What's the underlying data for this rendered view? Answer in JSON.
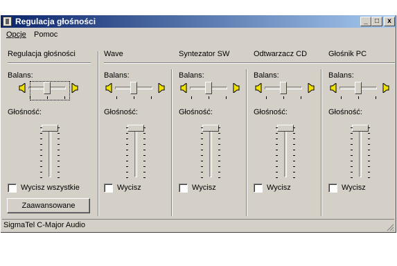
{
  "window": {
    "title": "Regulacja głośności",
    "minimize": "_",
    "maximize": "□",
    "close": "x"
  },
  "menu": {
    "options": "Opcje",
    "help": "Pomoc"
  },
  "master": {
    "title": "Regulacja głośności",
    "balance_label": "Balans:",
    "volume_label": "Głośność:",
    "mute_label": "Wycisz wszystkie",
    "advanced_button": "Zaawansowane",
    "muted": false,
    "balance": 0.5,
    "volume": 1.0
  },
  "channels": [
    {
      "title": "Wave",
      "balance_label": "Balans:",
      "volume_label": "Głośność:",
      "mute_label": "Wycisz",
      "muted": false,
      "balance": 0.5,
      "volume": 1.0
    },
    {
      "title": "Syntezator SW",
      "balance_label": "Balans:",
      "volume_label": "Głośność:",
      "mute_label": "Wycisz",
      "muted": false,
      "balance": 0.5,
      "volume": 1.0
    },
    {
      "title": "Odtwarzacz CD",
      "balance_label": "Balans:",
      "volume_label": "Głośność:",
      "mute_label": "Wycisz",
      "muted": false,
      "balance": 0.5,
      "volume": 1.0
    },
    {
      "title": "Głośnik PC",
      "balance_label": "Balans:",
      "volume_label": "Głośność:",
      "mute_label": "Wycisz",
      "muted": false,
      "balance": 0.5,
      "volume": 1.0
    }
  ],
  "status": {
    "device": "SigmaTel C-Major Audio"
  },
  "colors": {
    "face": "#d4d0c8",
    "title_start": "#0a246a",
    "title_end": "#a6caf0",
    "speaker": "#f0e000"
  }
}
